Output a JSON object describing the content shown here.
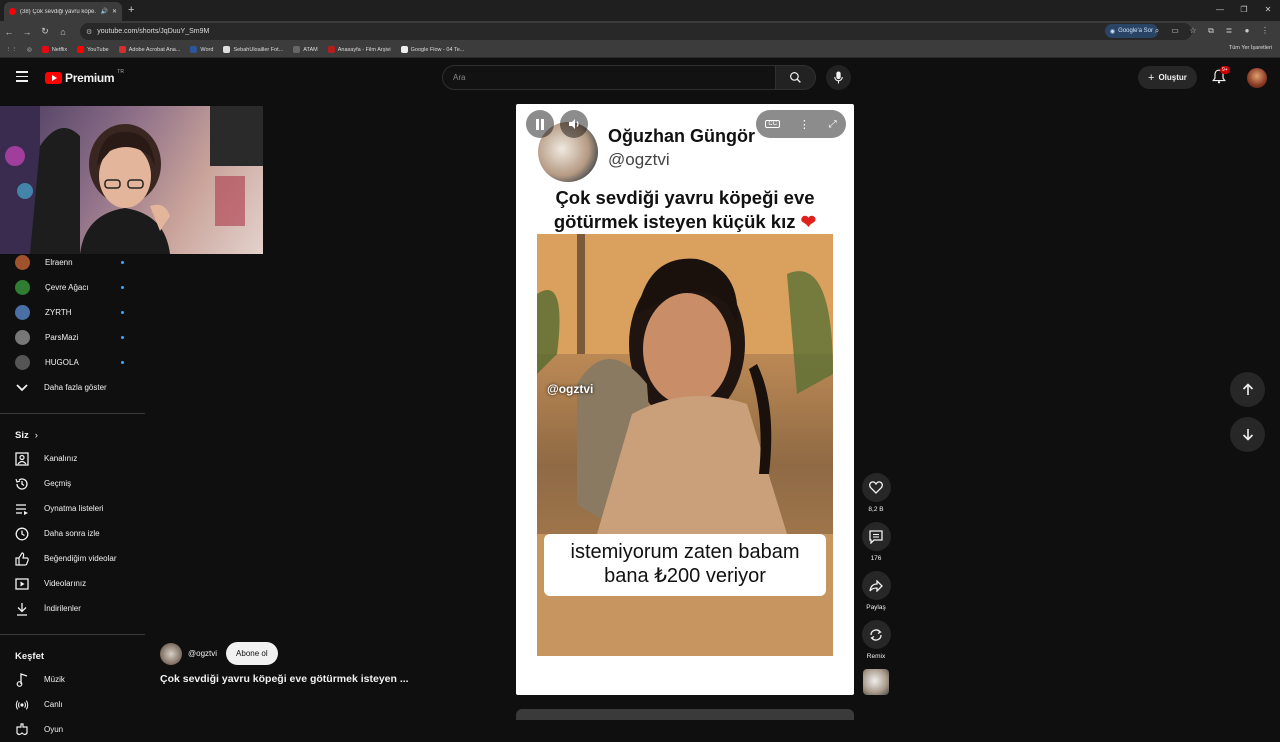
{
  "browser": {
    "tab_title": "(38) Çok sevdiği yavru köpe...",
    "url": "youtube.com/shorts/JqDuuY_Sm9M",
    "google_sor": "Google'a Sor",
    "bookmarks": [
      "Netflix",
      "YouTube",
      "Adobe Acrobat Ana...",
      "Word",
      "SebahUloailler Fot...",
      "ATAM",
      "Anasayfa - Film Arşivi",
      "Google Flow - 04 Te..."
    ],
    "all_bookmarks": "Tüm Yer İşaretleri"
  },
  "header": {
    "brand": "Premium",
    "region": "TR",
    "search_placeholder": "Ara",
    "create_label": "Oluştur",
    "notifications_badge": "9+"
  },
  "sidebar": {
    "subscriptions": [
      {
        "label": "Elraenn",
        "color": "#a0522d"
      },
      {
        "label": "Çevre Ağacı",
        "color": "#2e7d32"
      },
      {
        "label": "ZYRTH",
        "color": "#4a6fa5"
      },
      {
        "label": "ParsMazi",
        "color": "#777777"
      },
      {
        "label": "HUGOLA",
        "color": "#555555"
      }
    ],
    "show_more": "Daha fazla göster",
    "you_header": "Siz",
    "you_items": [
      "Kanalınız",
      "Geçmiş",
      "Oynatma listeleri",
      "Daha sonra izle",
      "Beğendiğim videolar",
      "Videolarınız",
      "İndirilenler"
    ],
    "explore_header": "Keşfet",
    "explore_items": [
      "Müzik",
      "Canlı",
      "Oyun"
    ]
  },
  "short": {
    "author_name": "Oğuzhan Güngör",
    "author_handle": "@ogztvi",
    "headline_line1": "Çok sevdiği yavru köpeği eve",
    "headline_line2": "götürmek isteyen küçük kız",
    "heart": "❤",
    "watermark": "@ogztvi",
    "subtitle_line1": "istemiyorum zaten babam",
    "subtitle_line2": "bana ₺200 veriyor",
    "cc_label": "CC"
  },
  "actions": {
    "likes": "8,2 B",
    "comments": "176",
    "share": "Paylaş",
    "remix": "Remix"
  },
  "channel": {
    "handle": "@ogztvi",
    "subscribe": "Abone ol",
    "title": "Çok sevdiği yavru köpeği eve götürmek isteyen ..."
  }
}
